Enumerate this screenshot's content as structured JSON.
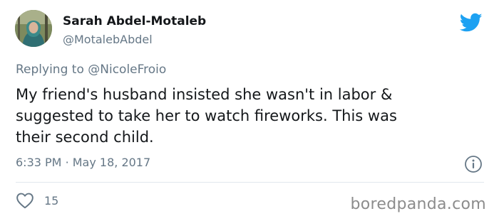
{
  "author": {
    "name": "Sarah Abdel-Motaleb",
    "handle": "@MotalebAbdel"
  },
  "reply": {
    "prefix": "Replying to",
    "mention": "@NicoleFroio"
  },
  "tweet": {
    "lines": [
      "My friend's husband insisted she wasn't in labor &",
      "suggested to take her to watch fireworks. This was",
      "their second child."
    ]
  },
  "meta": {
    "time": "6:33 PM",
    "separator": "·",
    "date": "May 18, 2017"
  },
  "actions": {
    "like_count": "15"
  },
  "watermark": "boredpanda.com",
  "icons": {
    "brand": "twitter-bird-icon",
    "info": "info-icon",
    "like": "heart-icon"
  },
  "colors": {
    "brand_blue": "#1da1f2",
    "text_primary": "#14171a",
    "text_secondary": "#657786",
    "divider": "#e1e8ed"
  }
}
